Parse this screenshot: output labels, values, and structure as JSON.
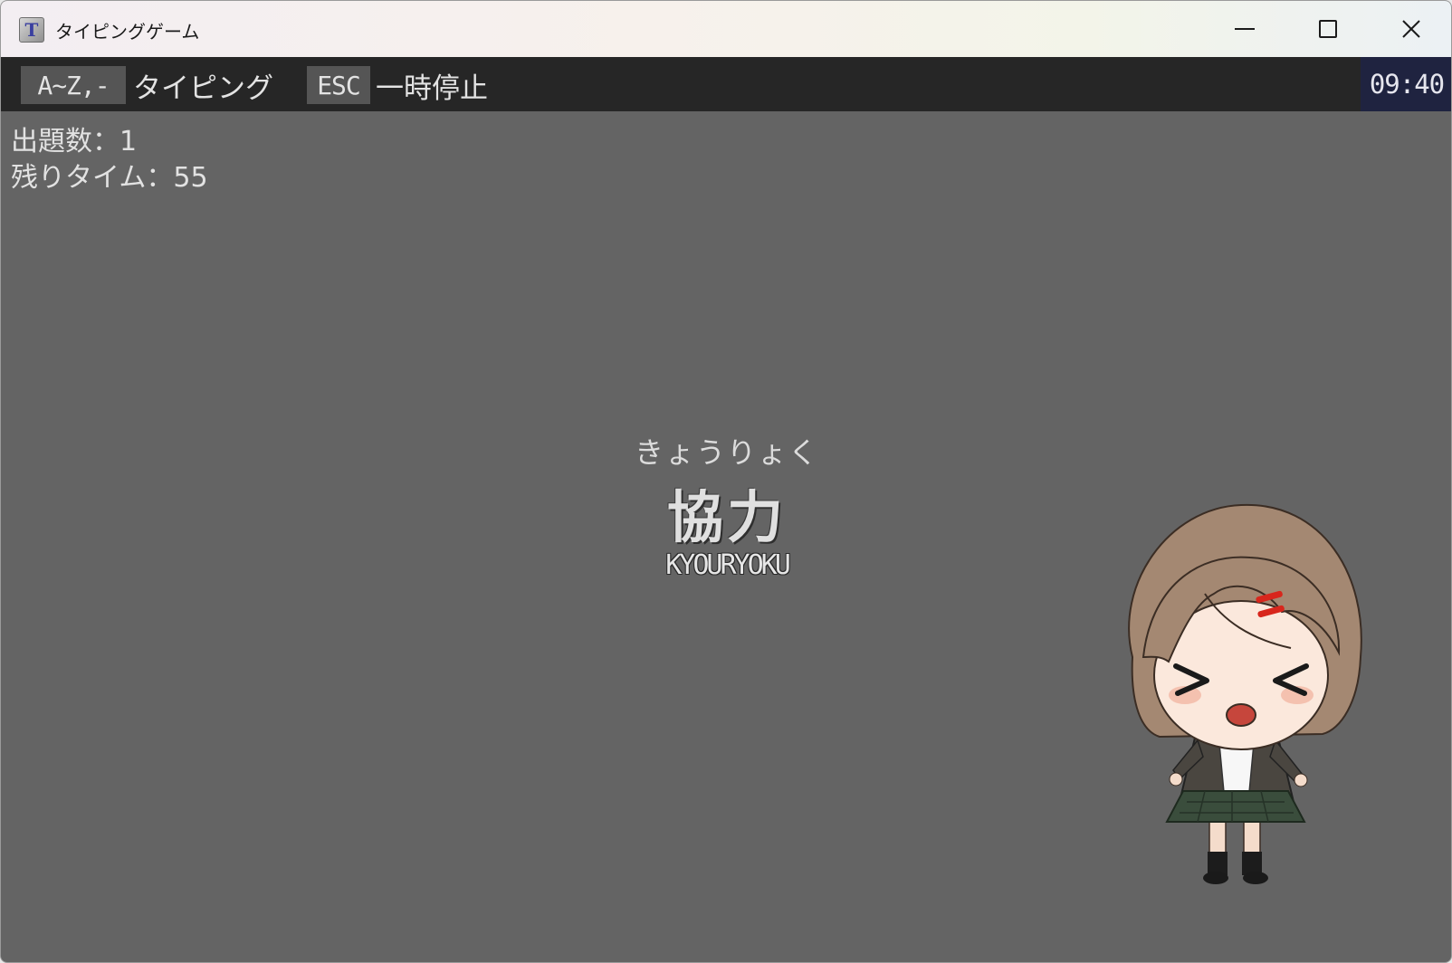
{
  "window": {
    "title": "タイピングゲーム",
    "app_icon_letter": "T"
  },
  "keybar": {
    "type_key": "A~Z,-",
    "type_label": "タイピング",
    "pause_key": "ESC",
    "pause_label": "一時停止",
    "clock": "09:40"
  },
  "stats": {
    "question_count_label": "出題数：",
    "question_count": "1",
    "time_left_label": "残りタイム：",
    "time_left": "55"
  },
  "question": {
    "reading": "きょうりょく",
    "word": "協力",
    "romaji": "KYOURYOKU"
  },
  "character": {
    "icon": "chibi-girl-character"
  },
  "colors": {
    "game_background": "#646464",
    "keybar_background": "#262626",
    "keycap_background": "#555555",
    "clock_background": "#1f2340"
  }
}
